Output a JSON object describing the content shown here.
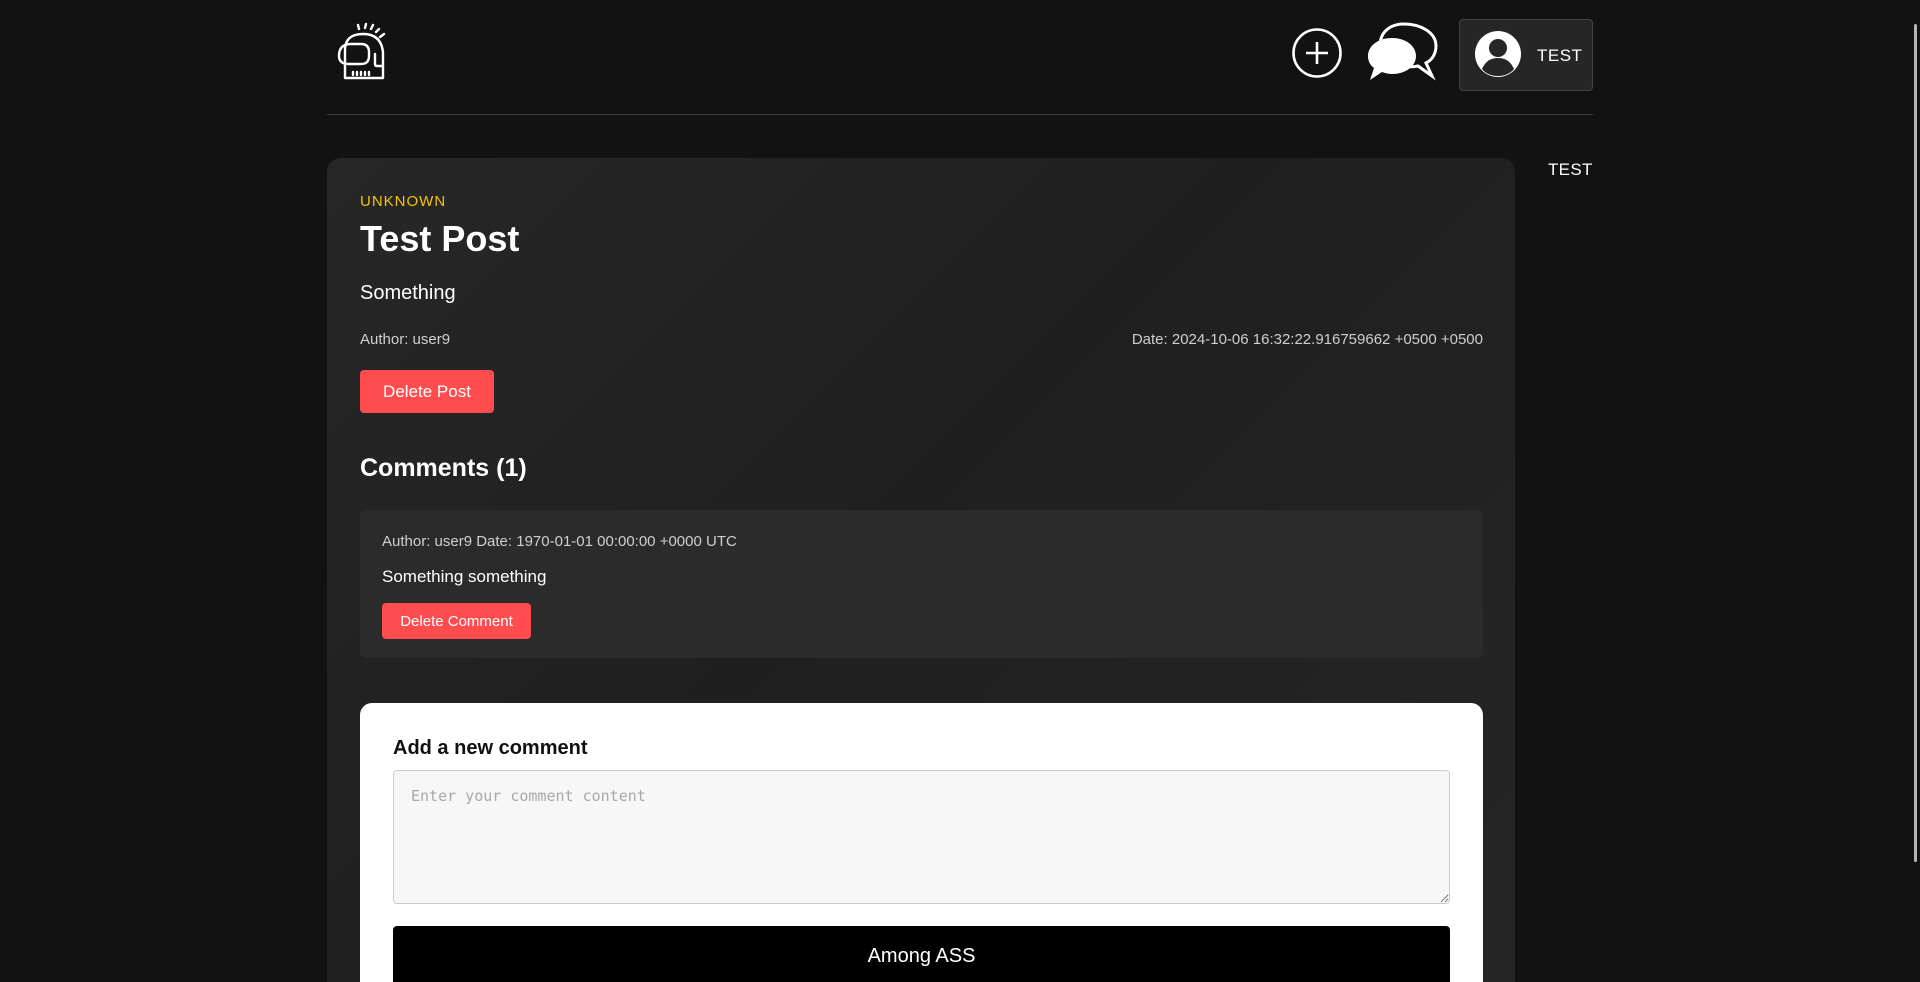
{
  "header": {
    "logo_icon": "helmet-logo-icon",
    "add_icon": "plus-circle-icon",
    "chat_icon": "chat-bubbles-icon",
    "profile": {
      "avatar_icon": "user-avatar-icon",
      "label": "TEST"
    }
  },
  "sidebar": {
    "username": "TEST"
  },
  "post": {
    "category": "UNKNOWN",
    "title": "Test Post",
    "body": "Something",
    "author": "Author: user9",
    "date": "Date: 2024-10-06 16:32:22.916759662 +0500 +0500",
    "delete_label": "Delete Post"
  },
  "comments": {
    "heading": "Comments (1)",
    "items": [
      {
        "meta": "Author: user9 Date: 1970-01-01 00:00:00 +0000 UTC",
        "text": "Something something",
        "delete_label": "Delete Comment"
      }
    ]
  },
  "new_comment": {
    "heading": "Add a new comment",
    "placeholder": "Enter your comment content",
    "value": "",
    "submit_label": "Among ASS"
  },
  "colors": {
    "background": "#121212",
    "card": "#242424",
    "accent_yellow": "#f5c400",
    "danger_red": "#ff4d4f"
  }
}
